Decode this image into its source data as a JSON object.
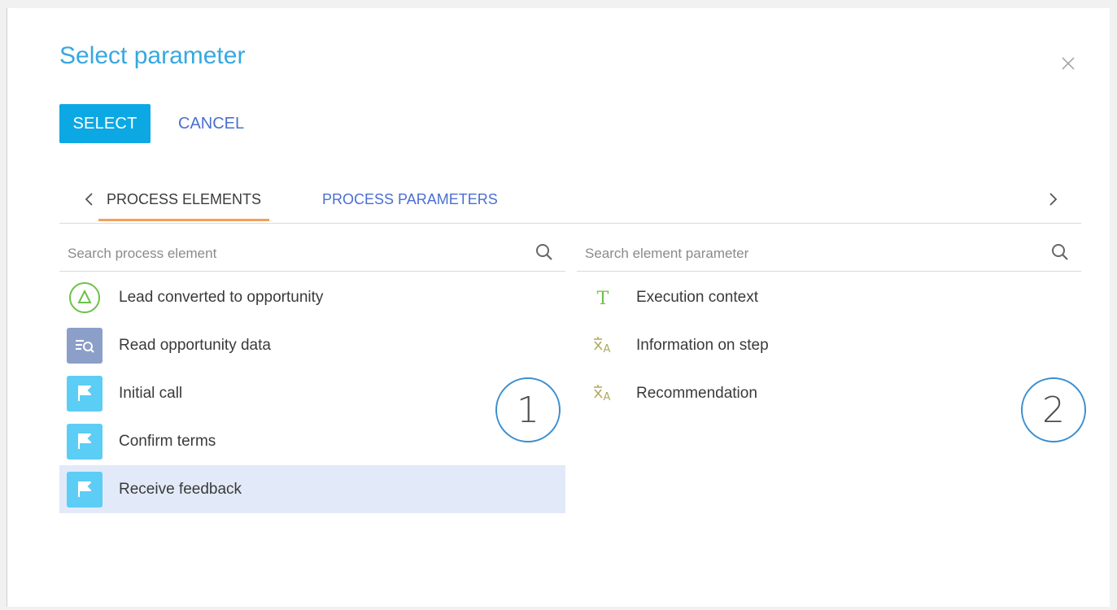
{
  "dialog": {
    "title": "Select parameter",
    "select_label": "SELECT",
    "cancel_label": "CANCEL"
  },
  "tabs": [
    {
      "label": "PROCESS ELEMENTS",
      "active": true
    },
    {
      "label": "PROCESS PARAMETERS",
      "active": false
    }
  ],
  "left_panel": {
    "search_placeholder": "Search process element",
    "items": [
      {
        "label": "Lead converted to opportunity",
        "icon": "signal-start-icon"
      },
      {
        "label": "Read opportunity data",
        "icon": "read-data-icon"
      },
      {
        "label": "Initial call",
        "icon": "flag-icon"
      },
      {
        "label": "Confirm terms",
        "icon": "flag-icon"
      },
      {
        "label": "Receive feedback",
        "icon": "flag-icon",
        "selected": true
      }
    ]
  },
  "right_panel": {
    "search_placeholder": "Search element parameter",
    "items": [
      {
        "label": "Execution context",
        "icon": "text-type-icon"
      },
      {
        "label": "Information on step",
        "icon": "localizable-text-icon"
      },
      {
        "label": "Recommendation",
        "icon": "localizable-text-icon"
      }
    ]
  },
  "annotations": [
    "1",
    "2"
  ],
  "colors": {
    "accent": "#0ca8e4",
    "title": "#36a8e1",
    "link": "#4a6fd2",
    "tab_underline": "#f5a05a",
    "selected_row": "#e2eaf9",
    "flag_tile": "#5ccdf5",
    "read_tile": "#8b9fc9",
    "start_green": "#6cc24a"
  }
}
